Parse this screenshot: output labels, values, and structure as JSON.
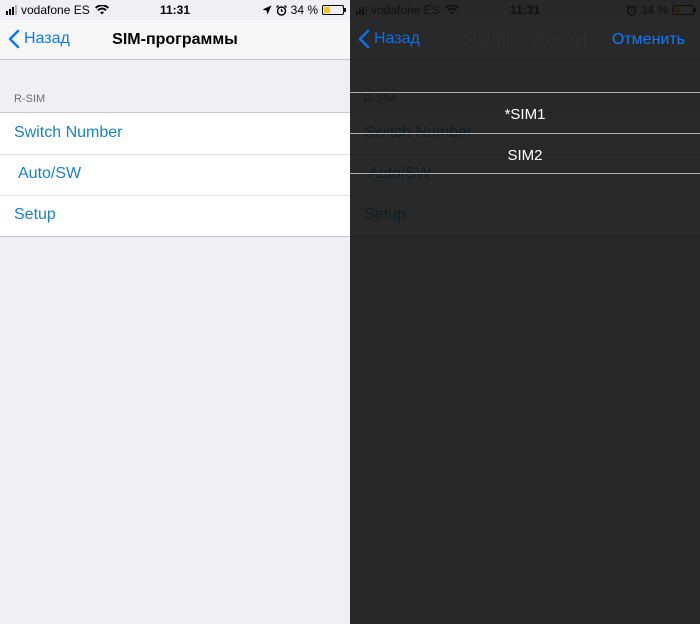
{
  "status": {
    "carrier": "vodafone ES",
    "time": "11:31",
    "battery": "34 %",
    "battery_level": 0.34
  },
  "nav": {
    "back_label": "Назад",
    "title": "SIM-программы",
    "cancel_label": "Отменить"
  },
  "section": {
    "header": "R-SIM",
    "items": [
      {
        "label": "Switch Number"
      },
      {
        "label": "Auto/SW"
      },
      {
        "label": "Setup"
      }
    ]
  },
  "picker": {
    "options": [
      {
        "label": "*SIM1"
      },
      {
        "label": "SIM2"
      }
    ]
  },
  "colors": {
    "accent": "#0a7aff",
    "link": "#1a82c4",
    "battery": "#f4c51b"
  }
}
